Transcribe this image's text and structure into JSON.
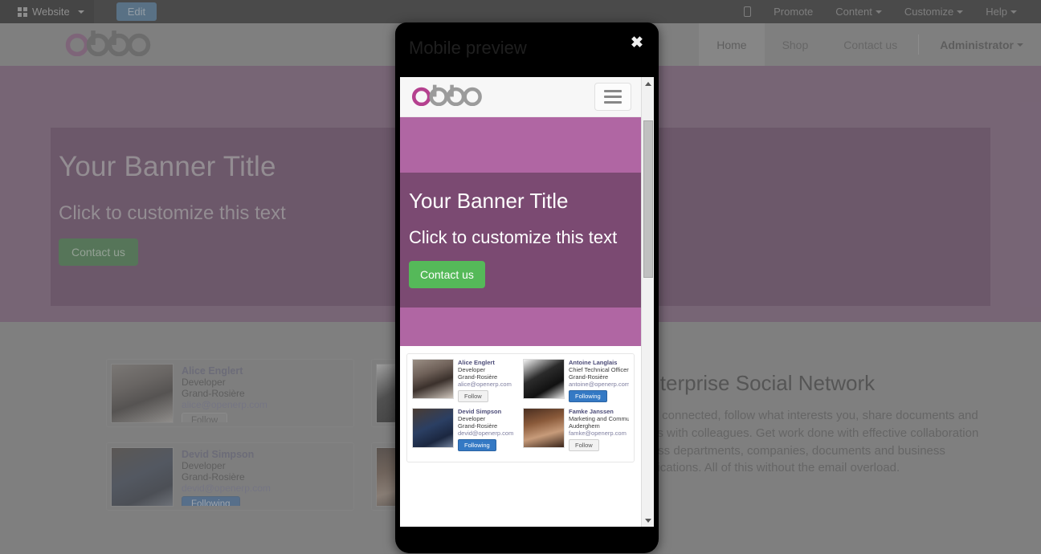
{
  "adminbar": {
    "app_menu_label": "Website",
    "edit_label": "Edit",
    "mobile_preview_icon": "mobile-icon",
    "items": [
      {
        "label": "Promote",
        "caret": false
      },
      {
        "label": "Content",
        "caret": true
      },
      {
        "label": "Customize",
        "caret": true
      },
      {
        "label": "Help",
        "caret": true
      }
    ]
  },
  "site_header": {
    "logo_text": "odoo",
    "nav": [
      {
        "label": "Home",
        "active": true
      },
      {
        "label": "Shop",
        "active": false
      },
      {
        "label": "Contact us",
        "active": false
      }
    ],
    "user_label": "Administrator"
  },
  "banner": {
    "title": "Your Banner Title",
    "subtitle": "Click to customize this text",
    "cta_label": "Contact us"
  },
  "social": {
    "heading": "Enterprise Social Network",
    "body": "Stay connected, follow what interests you, share documents and ideas with colleagues. Get work done with effective collaboration across departments, companies, documents and business applications. All of this without the email overload."
  },
  "people": [
    {
      "name": "Alice Englert",
      "job": "Developer",
      "city": "Grand-Rosière",
      "email": "alice@openerp.com",
      "button": "Follow",
      "following": false,
      "photo": "ph-alice"
    },
    {
      "name": "Antoine Langlais",
      "job": "Chief Technical Officer",
      "city": "Grand-Rosière",
      "email": "antoine@openerp.com",
      "button": "Following",
      "following": true,
      "photo": "ph-antoine"
    },
    {
      "name": "Devid Simpson",
      "job": "Developer",
      "city": "Grand-Rosière",
      "email": "devid@openerp.com",
      "button": "Following",
      "following": true,
      "photo": "ph-devid"
    },
    {
      "name": "Famke Janssen",
      "job": "Marketing and Community Manager",
      "city": "Auderghem",
      "email": "famke@openerp.com",
      "button": "Follow",
      "following": false,
      "photo": "ph-famke"
    }
  ],
  "modal": {
    "title": "Mobile preview",
    "close_label": "✖",
    "logo_text": "odoo",
    "menu_icon": "hamburger-icon",
    "scroll_up_icon": "scroll-up-arrow",
    "scroll_down_icon": "scroll-down-arrow"
  },
  "colors": {
    "admin_bar": "#141414",
    "edit_button": "#33638a",
    "brand_purple": "#b066a3",
    "banner_purple": "#7b4a72",
    "cta_green": "#55b959",
    "following_blue": "#3479c4",
    "odoo_logo_pink": "#b5418f",
    "odoo_logo_gray": "#8f8f8f"
  }
}
